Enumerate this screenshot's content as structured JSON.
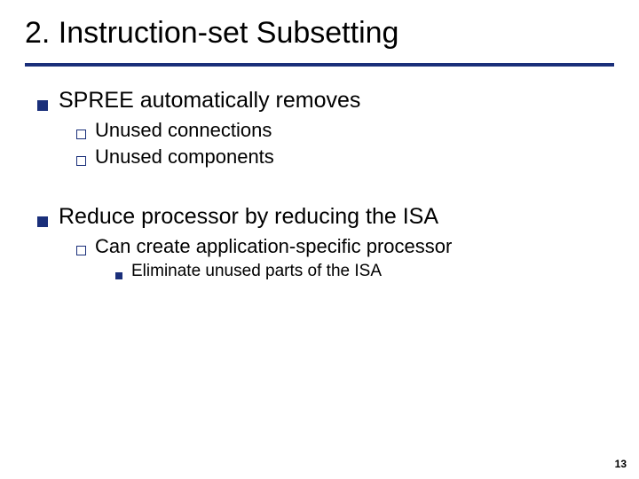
{
  "title": "2. Instruction-set Subsetting",
  "bullets": {
    "b1": "SPREE automatically removes",
    "b1a": "Unused connections",
    "b1b": "Unused components",
    "b2": "Reduce processor by reducing the ISA",
    "b2a": "Can create application-specific processor",
    "b2a1": "Eliminate unused parts of the ISA"
  },
  "page": "13"
}
